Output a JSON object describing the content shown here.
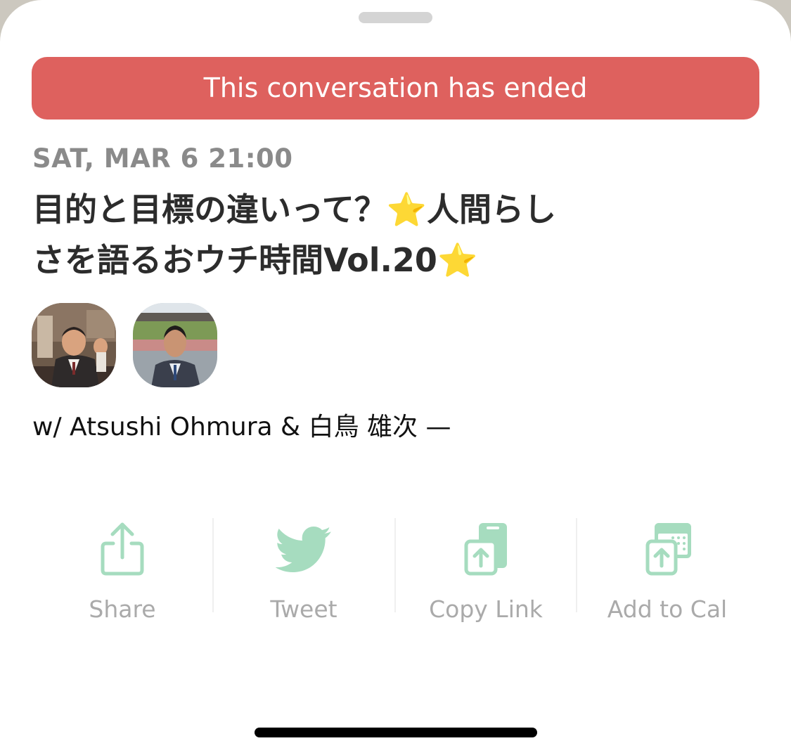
{
  "banner": {
    "text": "This conversation has ended",
    "color": "#de615e"
  },
  "event": {
    "date": "SAT, MAR 6 21:00",
    "title_line_1": "目的と目標の違いって？⭐人間らし",
    "title_line_2": "さを語るおウチ時間Vol.20⭐",
    "hosts": "w/ Atsushi Ohmura & 白鳥 雄次 —"
  },
  "speakers": [
    {
      "icon": "speaker-avatar-1"
    },
    {
      "icon": "speaker-avatar-2"
    }
  ],
  "actions": [
    {
      "label": "Share",
      "icon": "share-icon"
    },
    {
      "label": "Tweet",
      "icon": "twitter-bird-icon"
    },
    {
      "label": "Copy Link",
      "icon": "copy-link-icon"
    },
    {
      "label": "Add to Cal",
      "icon": "calendar-add-icon"
    }
  ],
  "colors": {
    "accent": "#a6dcbf",
    "label": "#aaaaaa",
    "title": "#2c2c2c",
    "date": "#8a8a8a"
  }
}
